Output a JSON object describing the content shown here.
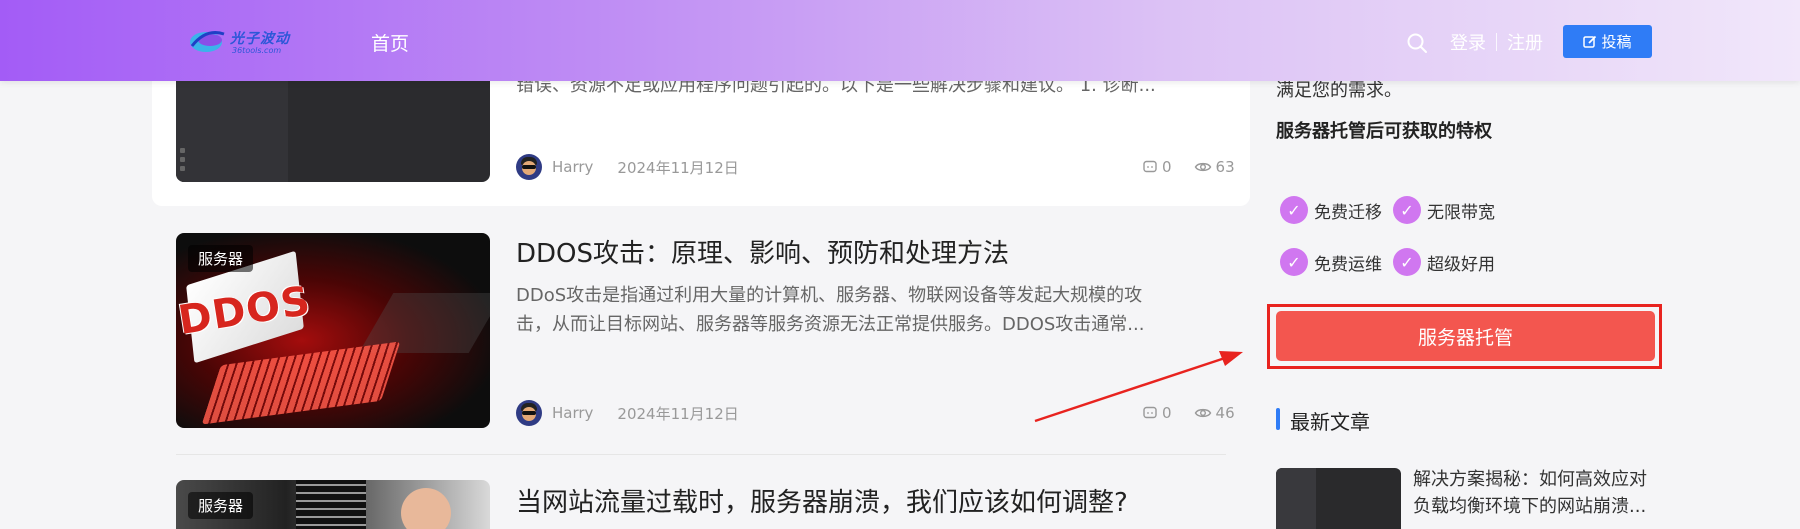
{
  "header": {
    "logo_text": "光子波动",
    "logo_sub": "36tools.com",
    "nav_home": "首页",
    "login": "登录",
    "register": "注册",
    "post_button": "投稿"
  },
  "articles": [
    {
      "excerpt": "错误、资源不足或应用程序问题引起的。以下是一些解决步骤和建议。 1. 诊断...",
      "author": "Harry",
      "date": "2024年11月12日",
      "comments": "0",
      "views": "63"
    },
    {
      "badge": "服务器",
      "title": "DDOS攻击：原理、影响、预防和处理方法",
      "excerpt_line1": "DDoS攻击是指通过利用大量的计算机、服务器、物联网设备等发起大规模的攻",
      "excerpt_line2": "击，从而让目标网站、服务器等服务资源无法正常提供服务。DDOS攻击通常...",
      "author": "Harry",
      "date": "2024年11月12日",
      "comments": "0",
      "views": "46"
    },
    {
      "badge": "服务器",
      "title": "当网站流量过载时，服务器崩溃，我们应该如何调整?"
    }
  ],
  "sidebar": {
    "text": "满足您的需求。",
    "heading": "服务器托管后可获取的特权",
    "perks": [
      "免费迁移",
      "无限带宽",
      "免费运维",
      "超级好用"
    ],
    "host_button": "服务器托管",
    "latest_title": "最新文章",
    "latest_item_title": "解决方案揭秘：如何高效应对负载均衡环境下的网站崩溃..."
  },
  "colors": {
    "accent_blue": "#2f7cf6",
    "host_button": "#f3564f",
    "annotation_red": "#e8231f",
    "check_purple": "#d077f0"
  }
}
